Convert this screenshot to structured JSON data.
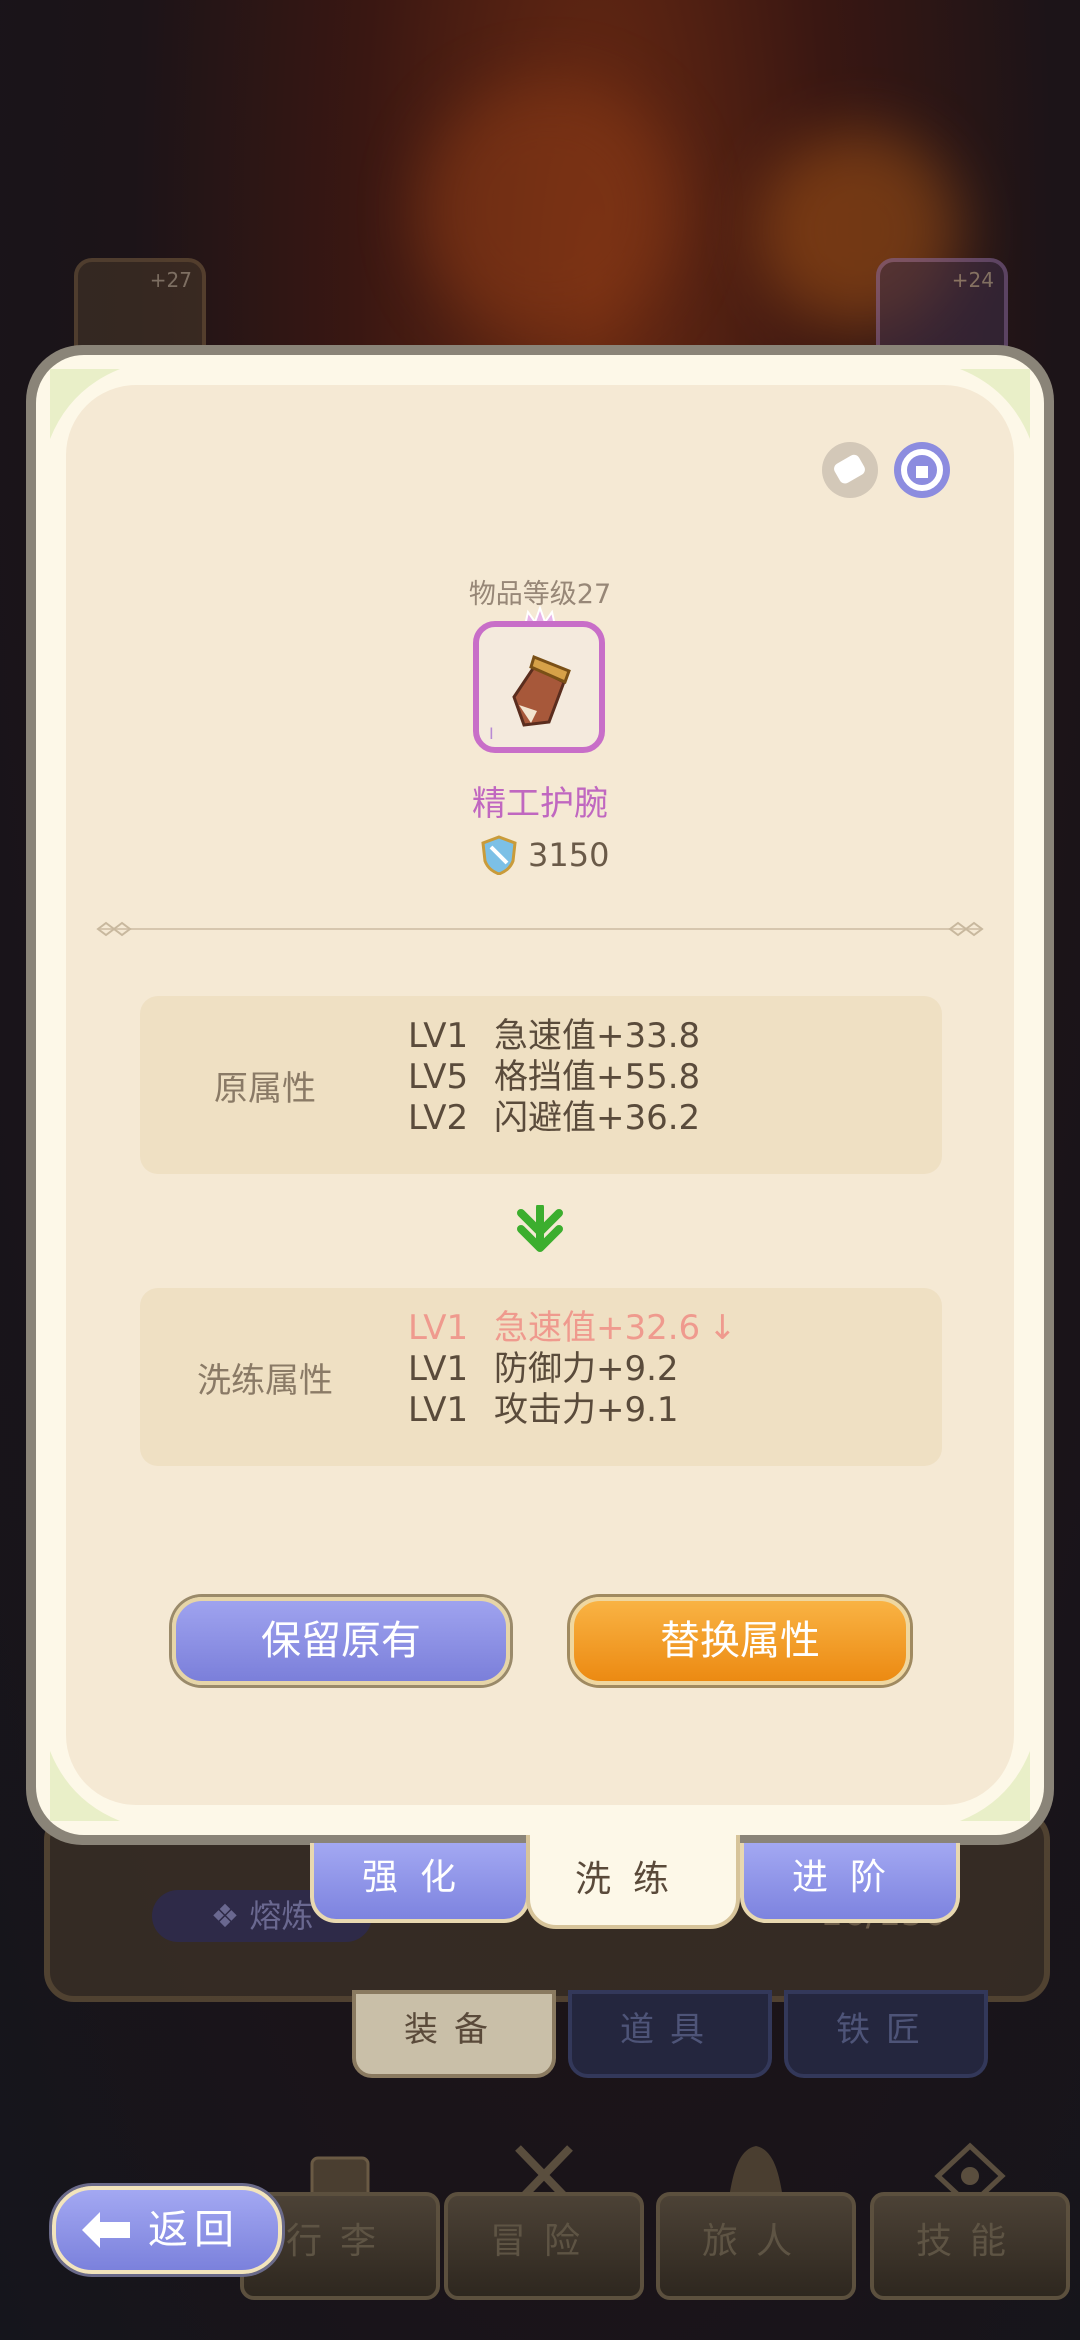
{
  "background": {
    "left_slot_level": "+27",
    "right_slot_level": "+24",
    "smelt_label": "熔炼",
    "capacity": "16/150",
    "category_tabs": [
      "装备",
      "道具",
      "铁匠"
    ],
    "bottom_nav": [
      "行李",
      "冒险",
      "旅人",
      "技能"
    ]
  },
  "item": {
    "level_text": "物品等级27",
    "name": "精工护腕",
    "power": "3150"
  },
  "original_attributes": {
    "title": "原属性",
    "lines": [
      {
        "lv": "LV1",
        "stat": "急速值+33.8"
      },
      {
        "lv": "LV5",
        "stat": "格挡值+55.8"
      },
      {
        "lv": "LV2",
        "stat": "闪避值+36.2"
      }
    ]
  },
  "reforged_attributes": {
    "title": "洗练属性",
    "lines": [
      {
        "lv": "LV1",
        "stat": "急速值+32.6",
        "trend": "↓"
      },
      {
        "lv": "LV1",
        "stat": "防御力+9.2"
      },
      {
        "lv": "LV1",
        "stat": "攻击力+9.1"
      }
    ]
  },
  "buttons": {
    "keep": "保留原有",
    "replace": "替换属性"
  },
  "tabs": [
    "强化",
    "洗练",
    "进阶"
  ],
  "active_tab": "洗练",
  "back_label": "返回",
  "colors": {
    "rarity_purple": "#c86ec8",
    "decrease_red": "#ef9a8e",
    "arrow_green": "#3cae2e",
    "button_blue": "#7b7fda",
    "button_orange": "#ec8a12"
  }
}
